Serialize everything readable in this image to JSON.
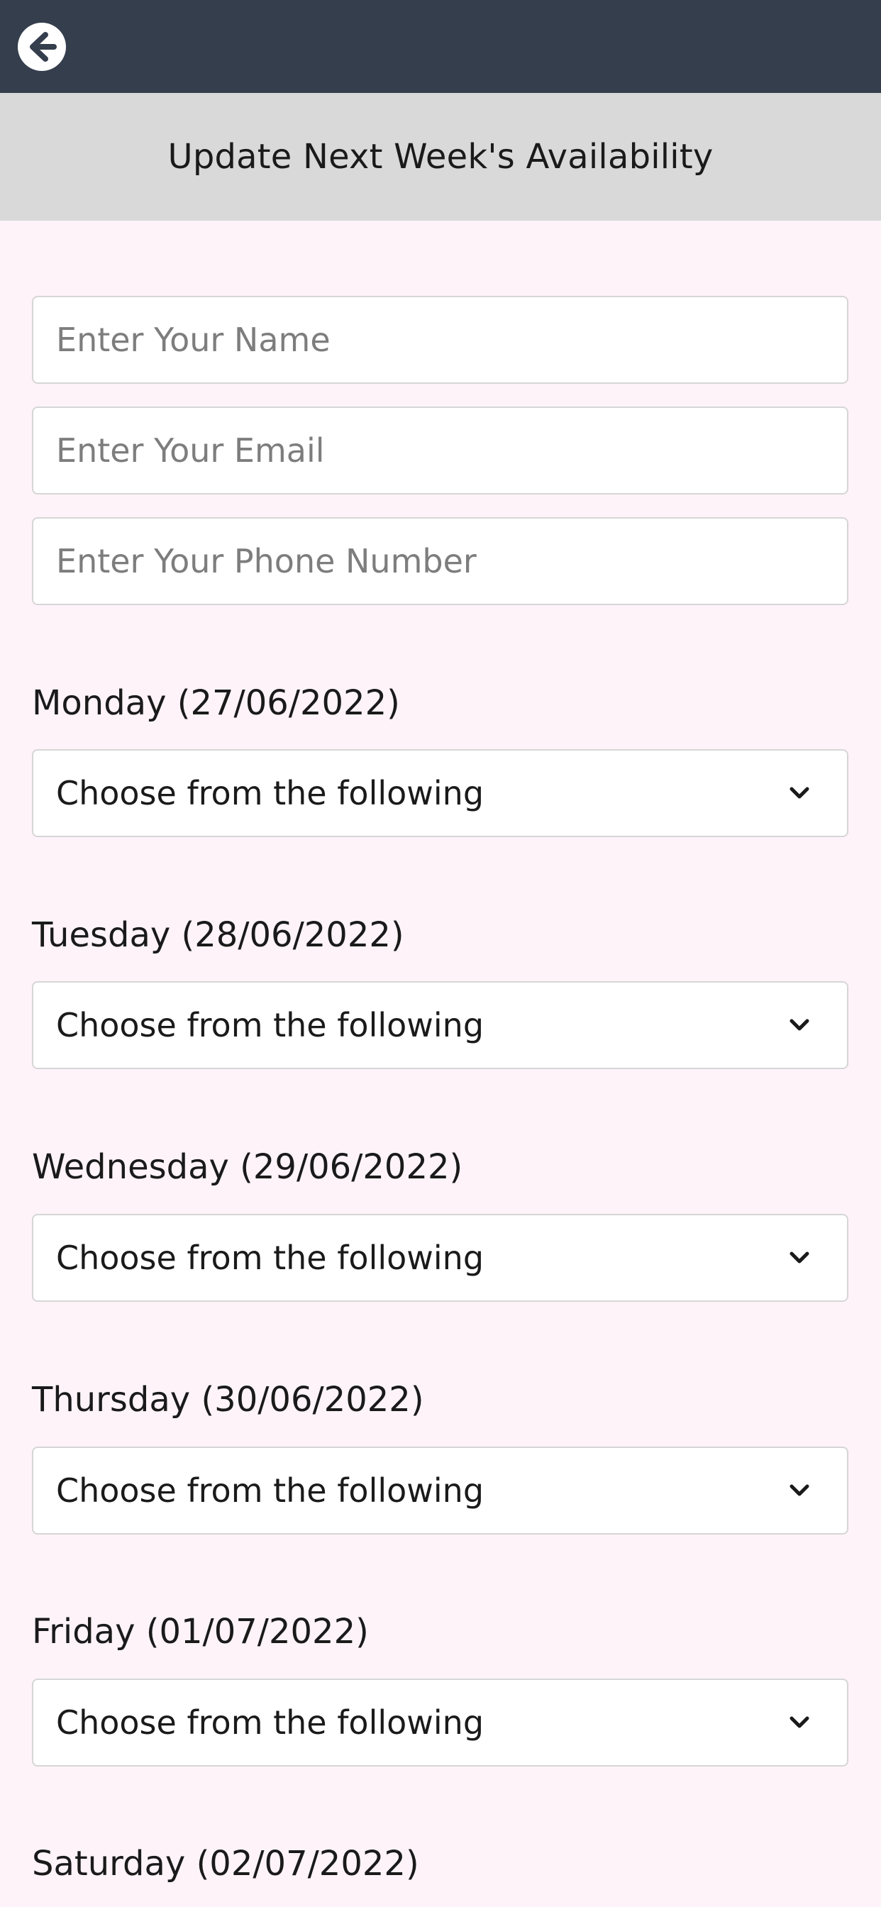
{
  "header": {
    "back_icon": "arrow-left-circle-icon",
    "bar_color": "#343e4d",
    "title": "Update Next Week's Availability"
  },
  "form": {
    "name_placeholder": "Enter Your Name",
    "email_placeholder": "Enter Your Email",
    "phone_placeholder": "Enter Your Phone Number"
  },
  "days": [
    {
      "label": "Monday (27/06/2022)",
      "selected": "Choose from the following"
    },
    {
      "label": "Tuesday (28/06/2022)",
      "selected": "Choose from the following"
    },
    {
      "label": "Wednesday (29/06/2022)",
      "selected": "Choose from the following"
    },
    {
      "label": "Thursday (30/06/2022)",
      "selected": "Choose from the following"
    },
    {
      "label": "Friday (01/07/2022)",
      "selected": "Choose from the following"
    },
    {
      "label": "Saturday (02/07/2022)"
    }
  ],
  "colors": {
    "background": "#fdf3f8",
    "title_band": "#d9d9d9"
  }
}
